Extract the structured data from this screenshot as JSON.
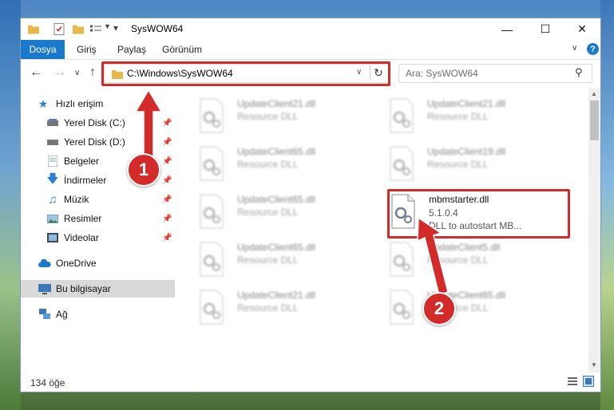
{
  "window": {
    "title": "SysWOW64"
  },
  "ribbon": {
    "file_tab": "Dosya",
    "tabs": [
      "Giriş",
      "Paylaş",
      "Görünüm"
    ]
  },
  "address": {
    "path": "C:\\Windows\\SysWOW64"
  },
  "search": {
    "placeholder": "Ara: SysWOW64"
  },
  "sidebar": {
    "quick_access": "Hızlı erişim",
    "items": [
      {
        "label": "Yerel Disk (C:)",
        "icon": "drive-icon"
      },
      {
        "label": "Yerel Disk (D:)",
        "icon": "drive-icon"
      },
      {
        "label": "Belgeler",
        "icon": "documents-icon"
      },
      {
        "label": "İndirmeler",
        "icon": "download-icon"
      },
      {
        "label": "Müzik",
        "icon": "music-icon"
      },
      {
        "label": "Resimler",
        "icon": "pictures-icon"
      },
      {
        "label": "Videolar",
        "icon": "videos-icon"
      }
    ],
    "onedrive": "OneDrive",
    "this_pc": "Bu bilgisayar",
    "network": "Ağ"
  },
  "files": {
    "left": [
      {
        "name": "UpdateClient21.dll",
        "type": "Resource DLL"
      },
      {
        "name": "UpdateClient65.dll",
        "type": "Resource DLL"
      },
      {
        "name": "UpdateClient65.dll",
        "type": "Resource DLL"
      },
      {
        "name": "UpdateClient65.dll",
        "type": "Resource DLL"
      },
      {
        "name": "UpdateClient21.dll",
        "type": "Resource DLL"
      }
    ],
    "right": [
      {
        "name": "UpdateClient21.dll",
        "type": "Resource DLL"
      },
      {
        "name": "UpdateClient19.dll",
        "type": "Resource DLL"
      },
      {
        "name": "UpdateClient5.dll",
        "type": "Resource DLL"
      },
      {
        "name": "UpdateClient65.dll",
        "type": "Resource DLL"
      }
    ],
    "highlighted": {
      "name": "mbmstarter.dll",
      "version": "5.1.0.4",
      "description": "DLL to autostart MB..."
    }
  },
  "status": {
    "count": "134 öğe"
  },
  "callouts": [
    "1",
    "2"
  ],
  "colors": {
    "accent": "#1979ca",
    "highlight": "#d32a2a"
  }
}
